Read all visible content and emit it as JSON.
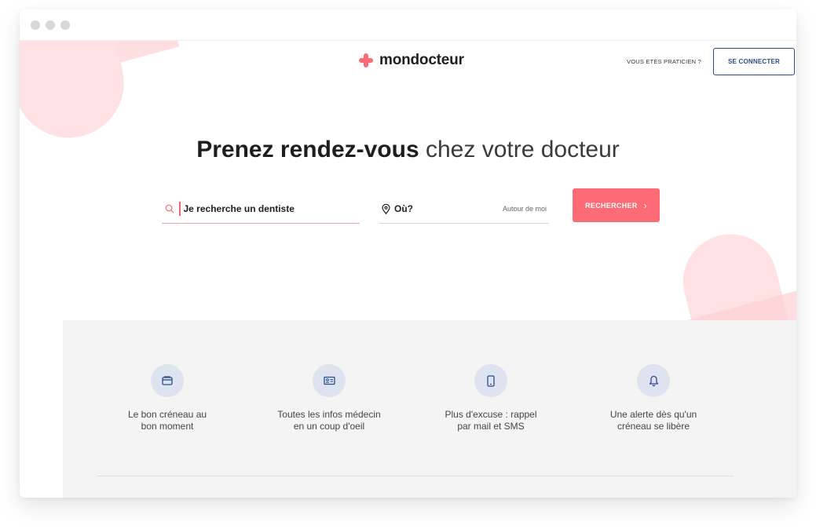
{
  "header": {
    "logo_text": "mondocteur",
    "praticien_link": "VOUS ETES PRATICIEN ?",
    "connect_button": "SE CONNECTER"
  },
  "hero": {
    "title_bold": "Prenez rendez-vous",
    "title_light": "chez votre docteur"
  },
  "search": {
    "what_value": "Je recherche un dentiste",
    "where_label": "Où?",
    "near_me": "Autour de moi",
    "button_label": "RECHERCHER",
    "button_chevron": "›"
  },
  "features": [
    {
      "icon": "calendar-icon",
      "line1": "Le bon créneau au",
      "line2": "bon moment"
    },
    {
      "icon": "id-card-icon",
      "line1": "Toutes les infos médecin",
      "line2": "en un coup d'oeil"
    },
    {
      "icon": "phone-icon",
      "line1": "Plus d'excuse : rappel",
      "line2": "par mail et SMS"
    },
    {
      "icon": "bell-icon",
      "line1": "Une alerte dès qu'un",
      "line2": "créneau se libère"
    }
  ],
  "colors": {
    "accent": "#ff6b74",
    "brand_blue": "#2b4c8a",
    "icon_bg": "#dde3ef",
    "section_bg": "#f4f4f4"
  }
}
